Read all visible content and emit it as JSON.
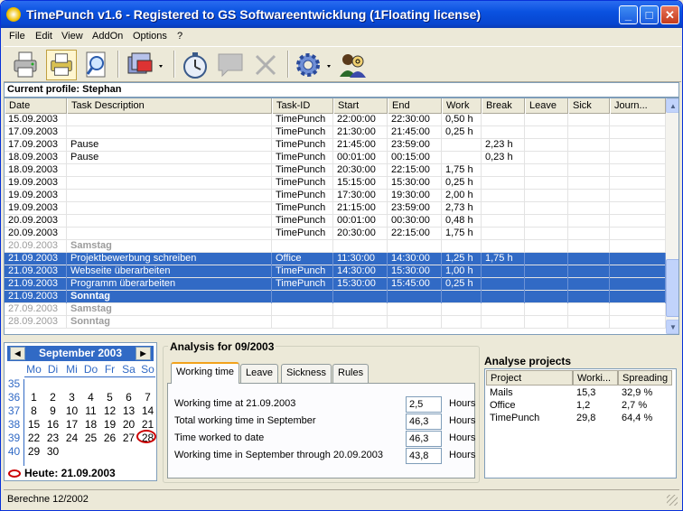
{
  "window": {
    "title": "TimePunch v1.6 - Registered to GS Softwareentwicklung (1Floating license)"
  },
  "menu": [
    "File",
    "Edit",
    "View",
    "AddOn",
    "Options",
    "?"
  ],
  "toolbar": [
    {
      "icon": "printer-icon"
    },
    {
      "icon": "print-preview-icon"
    },
    {
      "icon": "search-document-icon"
    },
    {
      "icon": "database-export-icon"
    },
    {
      "icon": "stopwatch-icon"
    },
    {
      "icon": "comment-icon"
    },
    {
      "icon": "delete-x-icon"
    },
    {
      "icon": "gear-icon"
    },
    {
      "icon": "users-icon"
    }
  ],
  "profile": {
    "text": "Current profile: Stephan"
  },
  "grid": {
    "columns": [
      "Date",
      "Task Description",
      "Task-ID",
      "Start",
      "End",
      "Work",
      "Break",
      "Leave",
      "Sick",
      "Journ..."
    ],
    "rows": [
      {
        "date": "15.09.2003",
        "desc": "",
        "task": "TimePunch",
        "start": "22:00:00",
        "end": "22:30:00",
        "work": "0,50 h",
        "brk": "",
        "style": ""
      },
      {
        "date": "17.09.2003",
        "desc": "",
        "task": "TimePunch",
        "start": "21:30:00",
        "end": "21:45:00",
        "work": "0,25 h",
        "brk": "",
        "style": ""
      },
      {
        "date": "17.09.2003",
        "desc": "Pause",
        "task": "TimePunch",
        "start": "21:45:00",
        "end": "23:59:00",
        "work": "",
        "brk": "2,23 h",
        "style": ""
      },
      {
        "date": "18.09.2003",
        "desc": "Pause",
        "task": "TimePunch",
        "start": "00:01:00",
        "end": "00:15:00",
        "work": "",
        "brk": "0,23 h",
        "style": ""
      },
      {
        "date": "18.09.2003",
        "desc": "",
        "task": "TimePunch",
        "start": "20:30:00",
        "end": "22:15:00",
        "work": "1,75 h",
        "brk": "",
        "style": ""
      },
      {
        "date": "19.09.2003",
        "desc": "",
        "task": "TimePunch",
        "start": "15:15:00",
        "end": "15:30:00",
        "work": "0,25 h",
        "brk": "",
        "style": ""
      },
      {
        "date": "19.09.2003",
        "desc": "",
        "task": "TimePunch",
        "start": "17:30:00",
        "end": "19:30:00",
        "work": "2,00 h",
        "brk": "",
        "style": ""
      },
      {
        "date": "19.09.2003",
        "desc": "",
        "task": "TimePunch",
        "start": "21:15:00",
        "end": "23:59:00",
        "work": "2,73 h",
        "brk": "",
        "style": ""
      },
      {
        "date": "20.09.2003",
        "desc": "",
        "task": "TimePunch",
        "start": "00:01:00",
        "end": "00:30:00",
        "work": "0,48 h",
        "brk": "",
        "style": ""
      },
      {
        "date": "20.09.2003",
        "desc": "",
        "task": "TimePunch",
        "start": "20:30:00",
        "end": "22:15:00",
        "work": "1,75 h",
        "brk": "",
        "style": ""
      },
      {
        "date": "20.09.2003",
        "desc": "Samstag",
        "task": "",
        "start": "",
        "end": "",
        "work": "",
        "brk": "",
        "style": "gray bold"
      },
      {
        "date": "21.09.2003",
        "desc": "Projektbewerbung schreiben",
        "task": "Office",
        "start": "11:30:00",
        "end": "14:30:00",
        "work": "1,25 h",
        "brk": "1,75 h",
        "style": "sel"
      },
      {
        "date": "21.09.2003",
        "desc": "Webseite überarbeiten",
        "task": "TimePunch",
        "start": "14:30:00",
        "end": "15:30:00",
        "work": "1,00 h",
        "brk": "",
        "style": "sel"
      },
      {
        "date": "21.09.2003",
        "desc": "Programm überarbeiten",
        "task": "TimePunch",
        "start": "15:30:00",
        "end": "15:45:00",
        "work": "0,25 h",
        "brk": "",
        "style": "sel"
      },
      {
        "date": "21.09.2003",
        "desc": "Sonntag",
        "task": "",
        "start": "",
        "end": "",
        "work": "",
        "brk": "",
        "style": "sel bold"
      },
      {
        "date": "27.09.2003",
        "desc": "Samstag",
        "task": "",
        "start": "",
        "end": "",
        "work": "",
        "brk": "",
        "style": "gray bold"
      },
      {
        "date": "28.09.2003",
        "desc": "Sonntag",
        "task": "",
        "start": "",
        "end": "",
        "work": "",
        "brk": "",
        "style": "gray bold"
      }
    ]
  },
  "calendar": {
    "month": "September 2003",
    "dow": [
      "Mo",
      "Di",
      "Mi",
      "Do",
      "Fr",
      "Sa",
      "So"
    ],
    "weeks": [
      {
        "wk": "35",
        "days": [
          "",
          "",
          "",
          "",
          "",
          "",
          ""
        ]
      },
      {
        "wk": "36",
        "days": [
          "1",
          "2",
          "3",
          "4",
          "5",
          "6",
          "7"
        ]
      },
      {
        "wk": "37",
        "days": [
          "8",
          "9",
          "10",
          "11",
          "12",
          "13",
          "14"
        ]
      },
      {
        "wk": "38",
        "days": [
          "15",
          "16",
          "17",
          "18",
          "19",
          "20",
          "21"
        ]
      },
      {
        "wk": "39",
        "days": [
          "22",
          "23",
          "24",
          "25",
          "26",
          "27",
          "28"
        ]
      },
      {
        "wk": "40",
        "days": [
          "29",
          "30",
          "",
          "",
          "",
          "",
          ""
        ]
      }
    ],
    "today": "Heute: 21.09.2003",
    "today_color": "#cc0000"
  },
  "analysis": {
    "title": "Analysis for 09/2003",
    "tabs": [
      "Working time",
      "Leave",
      "Sickness",
      "Rules"
    ],
    "rows": [
      {
        "label": "Working time at 21.09.2003",
        "value": "2,5",
        "unit": "Hours"
      },
      {
        "label": "Total working time in September",
        "value": "46,3",
        "unit": "Hours"
      },
      {
        "label": "Time worked to date",
        "value": "46,3",
        "unit": "Hours"
      },
      {
        "label": "Working time in September through 20.09.2003",
        "value": "43,8",
        "unit": "Hours"
      }
    ]
  },
  "projects": {
    "title": "Analyse projects",
    "columns": [
      "Project",
      "Worki...",
      "Spreading"
    ],
    "rows": [
      {
        "name": "Mails",
        "work": "15,3",
        "spread": "32,9 %"
      },
      {
        "name": "Office",
        "work": "1,2",
        "spread": "2,7 %"
      },
      {
        "name": "TimePunch",
        "work": "29,8",
        "spread": "64,4 %"
      }
    ]
  },
  "status": {
    "text": "Berechne 12/2002"
  },
  "colors": {
    "selection": "#316ac5",
    "titlebar": "#0a52e0"
  }
}
